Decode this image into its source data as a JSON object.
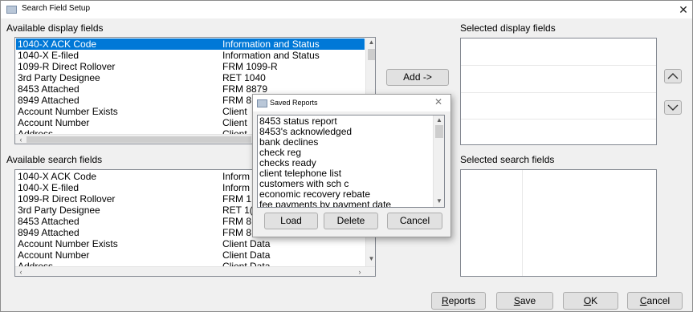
{
  "window": {
    "title": "Search Field Setup",
    "close_glyph": "✕"
  },
  "available_display": {
    "label": "Available display fields",
    "rows": [
      [
        "1040-X ACK Code",
        "Information and Status"
      ],
      [
        "1040-X E-filed",
        "Information and Status"
      ],
      [
        "1099-R Direct Rollover",
        "FRM 1099-R"
      ],
      [
        "3rd Party Designee",
        "RET 1040"
      ],
      [
        "8453 Attached",
        "FRM 8879"
      ],
      [
        "8949 Attached",
        "FRM 8"
      ],
      [
        "Account Number Exists",
        "Client"
      ],
      [
        "Account Number",
        "Client"
      ],
      [
        "Address",
        "Client"
      ]
    ],
    "selected_index": 0
  },
  "available_search": {
    "label": "Available search fields",
    "rows": [
      [
        "1040-X ACK Code",
        "Inform"
      ],
      [
        "1040-X E-filed",
        "Inform"
      ],
      [
        "1099-R Direct Rollover",
        "FRM 1"
      ],
      [
        "3rd Party Designee",
        "RET 1("
      ],
      [
        "8453 Attached",
        "FRM 8"
      ],
      [
        "8949 Attached",
        "FRM 8"
      ],
      [
        "Account Number Exists",
        "Client Data"
      ],
      [
        "Account Number",
        "Client Data"
      ],
      [
        "Address",
        "Client Data"
      ]
    ]
  },
  "selected_display": {
    "label": "Selected display fields"
  },
  "selected_search": {
    "label": "Selected search fields"
  },
  "buttons": {
    "add": "Add ->",
    "reports_u": "R",
    "reports_rest": "eports",
    "save_u": "S",
    "save_rest": "ave",
    "ok_u": "O",
    "ok_rest": "K",
    "cancel_u": "C",
    "cancel_rest": "ancel"
  },
  "dialog": {
    "title": "Saved Reports",
    "close_glyph": "✕",
    "items": [
      "8453 status report",
      "8453's acknowledged",
      "bank declines",
      "check reg",
      "checks ready",
      "client telephone list",
      "customers with sch c",
      "economic recovery rebate",
      "fee payments by payment date"
    ],
    "load": "Load",
    "delete": "Delete",
    "cancel": "Cancel"
  },
  "icons": {
    "app": "window-icon",
    "up": "chevron-up-icon",
    "down": "chevron-down-icon"
  }
}
